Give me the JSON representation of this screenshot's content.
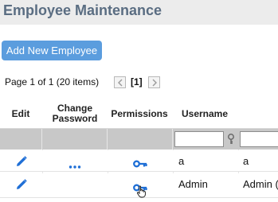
{
  "page": {
    "title": "Employee Maintenance"
  },
  "toolbar": {
    "add_label": "Add New Employee"
  },
  "pager": {
    "summary": "Page 1 of 1 (20 items)",
    "current": "[1]"
  },
  "grid": {
    "columns": [
      {
        "key": "edit",
        "label": "Edit"
      },
      {
        "key": "change_password",
        "label": "Change Password"
      },
      {
        "key": "permissions",
        "label": "Permissions"
      },
      {
        "key": "username",
        "label": "Username"
      }
    ],
    "filter": {
      "username_value": "",
      "next_value": ""
    },
    "rows": [
      {
        "username": "a",
        "next_col": "a"
      },
      {
        "username": "Admin",
        "next_col": "Admin ("
      }
    ]
  },
  "icons": {
    "edit": "pencil-icon",
    "change_password": "ellipsis-icon",
    "permissions": "key-icon",
    "filter": "filter-key-icon",
    "cursor": "hand-cursor-icon"
  },
  "colors": {
    "title": "#5a6d82",
    "button": "#5b9dde",
    "icon": "#1f6fd6",
    "filter_bar": "#c8c8c8"
  }
}
